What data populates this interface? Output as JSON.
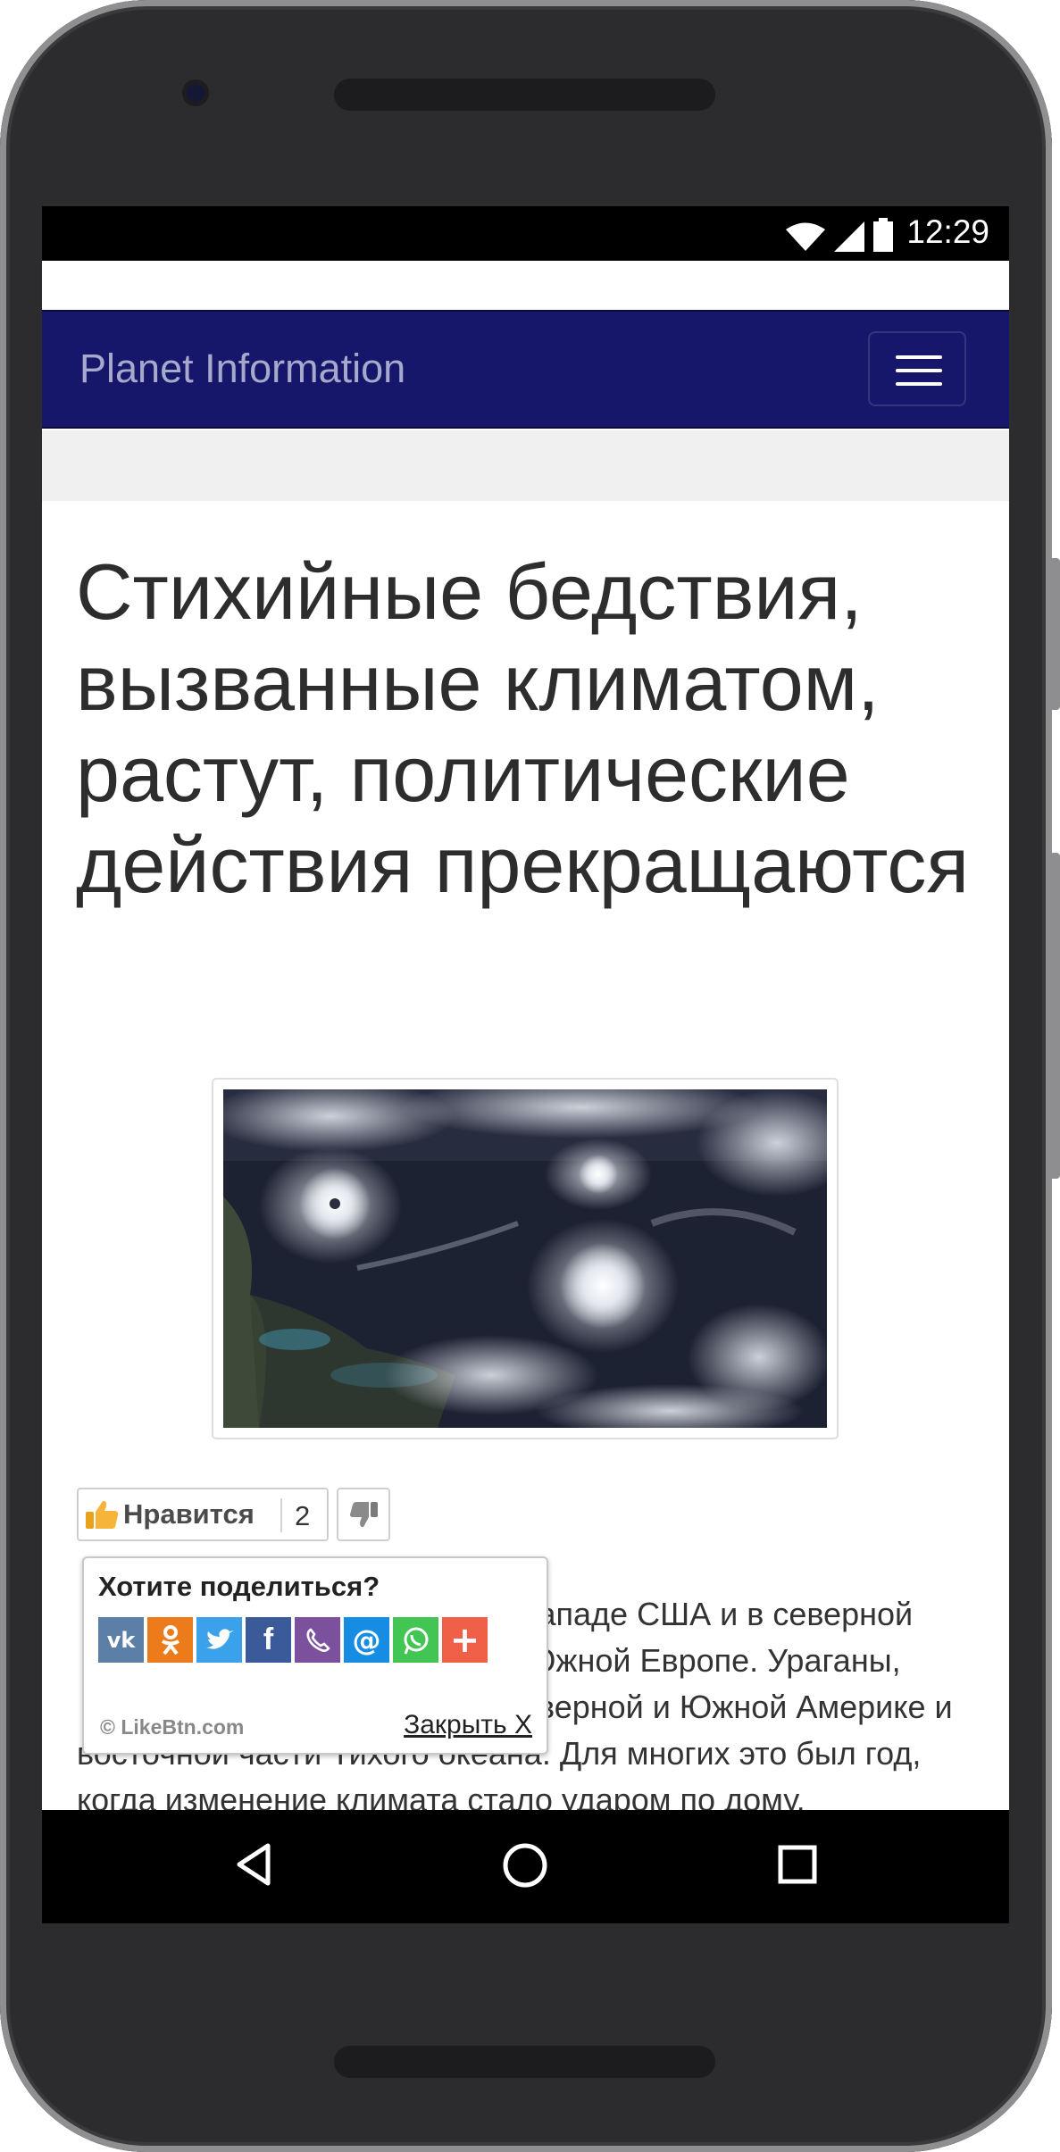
{
  "status_bar": {
    "time": "12:29",
    "icons": [
      "wifi-icon",
      "signal-icon",
      "battery-icon"
    ]
  },
  "navbar": {
    "brand": "Planet Information",
    "menu_icon": "hamburger-menu-icon",
    "background": "#16166a"
  },
  "article": {
    "title": "Стихийные бедствия, вызванные климатом, растут, политические действия прекращаются",
    "image_description_icon": "satellite-hurricanes-image",
    "like": {
      "label": "Нравится",
      "count": "2"
    },
    "body_lines": [
      "запад­е США и в северной",
      "Южной Европе. Ураганы,",
      "Северной и Южной Америке и",
      "восточной части Тихого океана. Для многих это был год,",
      "когда изменение климата стало ударом по дому."
    ]
  },
  "share_popup": {
    "title": "Хотите поделиться?",
    "services": [
      "vk",
      "odnoklassniki",
      "twitter",
      "facebook",
      "viber",
      "mail",
      "whatsapp",
      "more"
    ],
    "service_colors": [
      "#5b7fa6",
      "#eb7b1b",
      "#3aa1ea",
      "#3b5a9a",
      "#7b519d",
      "#168de2",
      "#43c553",
      "#f05f47"
    ],
    "brand": "© LikeBtn.com",
    "close": "Закрыть X"
  },
  "system_nav": {
    "back": "back-triangle-icon",
    "home": "home-circle-icon",
    "recents": "recents-square-icon"
  }
}
